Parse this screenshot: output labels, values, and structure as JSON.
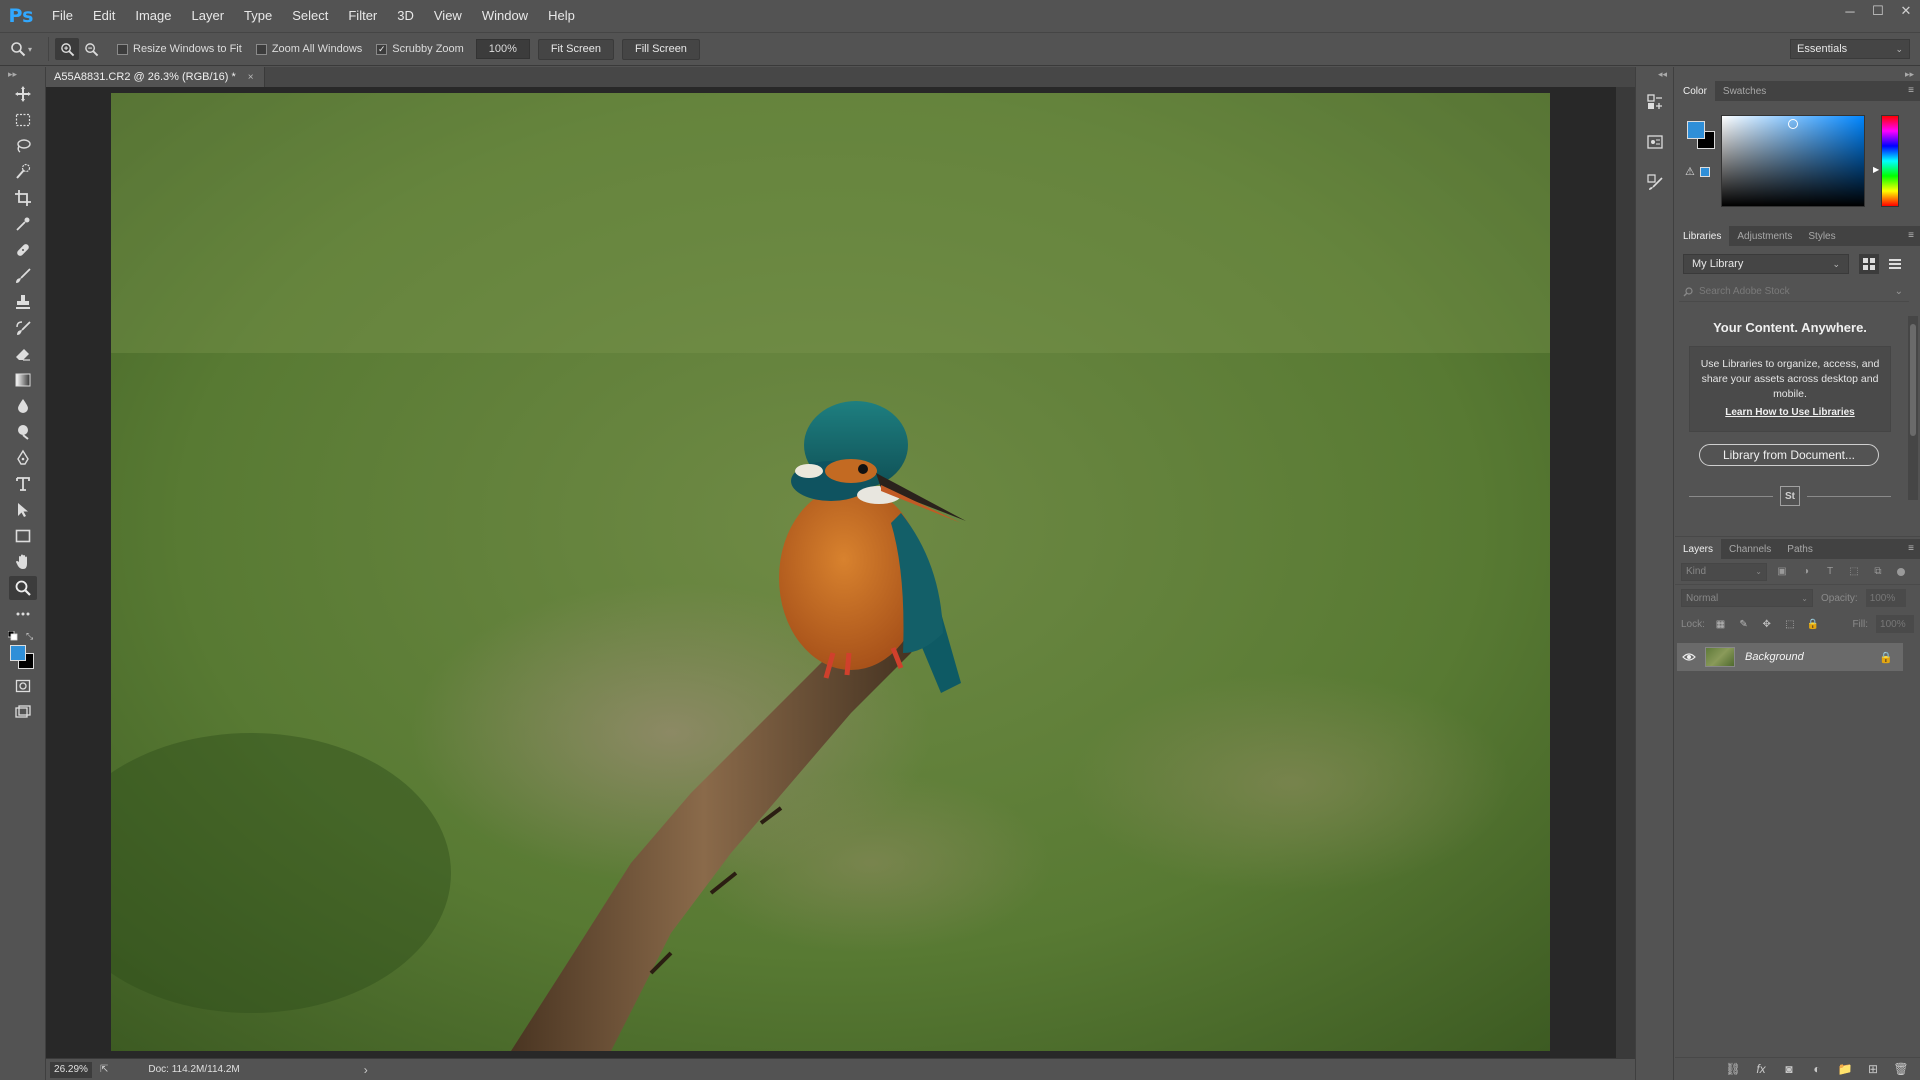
{
  "app": {
    "logo": "Ps"
  },
  "menu": [
    "File",
    "Edit",
    "Image",
    "Layer",
    "Type",
    "Select",
    "Filter",
    "3D",
    "View",
    "Window",
    "Help"
  ],
  "window_controls": {
    "minimize": "─",
    "maximize": "☐",
    "close": "✕"
  },
  "options": {
    "resize_windows_label": "Resize Windows to Fit",
    "resize_windows_checked": false,
    "zoom_all_label": "Zoom All Windows",
    "zoom_all_checked": false,
    "scrubby_zoom_label": "Scrubby Zoom",
    "scrubby_zoom_checked": true,
    "zoom_value": "100%",
    "fit_screen_label": "Fit Screen",
    "fill_screen_label": "Fill Screen",
    "workspace": "Essentials"
  },
  "document": {
    "tab_title": "A55A8831.CR2 @ 26.3% (RGB/16) *",
    "tab_close": "×"
  },
  "status": {
    "zoom": "26.29%",
    "doc_size": "Doc: 114.2M/114.2M",
    "arrow": "›"
  },
  "color_panel": {
    "tabs": [
      "Color",
      "Swatches"
    ],
    "foreground": "#2f8fd8",
    "background": "#000000"
  },
  "libraries_panel": {
    "tabs": [
      "Libraries",
      "Adjustments",
      "Styles"
    ],
    "library_name": "My Library",
    "search_placeholder": "Search Adobe Stock",
    "heading": "Your Content. Anywhere.",
    "info_text": "Use Libraries to organize, access, and share your assets across desktop and mobile.",
    "info_link": "Learn How to Use Libraries",
    "from_document_button": "Library from Document...",
    "stock_badge": "St"
  },
  "layers_panel": {
    "tabs": [
      "Layers",
      "Channels",
      "Paths"
    ],
    "kind_label": "Kind",
    "blend_mode": "Normal",
    "opacity_label": "Opacity:",
    "opacity_value": "100%",
    "lock_label": "Lock:",
    "fill_label": "Fill:",
    "fill_value": "100%",
    "layers": [
      {
        "name": "Background",
        "visible": true,
        "locked": true
      }
    ]
  },
  "colors": {
    "ui_dark": "#535353",
    "canvas_bg": "#282828",
    "accent": "#31a8ff"
  }
}
